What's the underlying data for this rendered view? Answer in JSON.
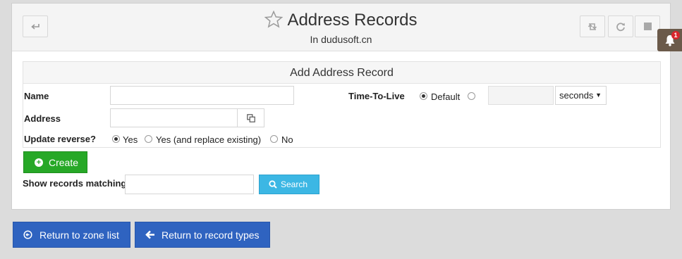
{
  "header": {
    "title": "Address Records",
    "subtitle": "In dudusoft.cn",
    "notification_count": "1"
  },
  "form": {
    "heading": "Add Address Record",
    "name_label": "Name",
    "name_value": "",
    "address_label": "Address",
    "address_value": "",
    "ttl_label": "Time-To-Live",
    "ttl_default_label": "Default",
    "ttl_value": "",
    "ttl_unit": "seconds",
    "update_reverse_label": "Update reverse?",
    "reverse_options": [
      "Yes",
      "Yes (and replace existing)",
      "No"
    ],
    "reverse_selected": "Yes",
    "create_label": "Create"
  },
  "search": {
    "label": "Show records matching:",
    "value": "",
    "button_label": "Search"
  },
  "footer": {
    "return_zone_label": "Return to zone list",
    "return_types_label": "Return to record types"
  },
  "colors": {
    "create_button": "#27a827",
    "search_button": "#3cb7e4",
    "return_button": "#2f63c0",
    "notification_bg": "#6b5a4a",
    "badge": "#d9262c"
  }
}
